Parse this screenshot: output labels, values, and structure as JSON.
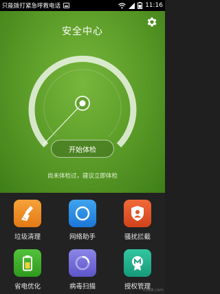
{
  "status_bar": {
    "emergency_text": "只能拨打紧急呼救电话",
    "time": "11:16"
  },
  "header": {
    "title": "安全中心",
    "settings_icon": "gear-icon"
  },
  "scan": {
    "button_label": "开始体检",
    "hint": "尚未体检过，建议立即体检"
  },
  "tools": [
    {
      "label": "垃圾清理",
      "icon": "broom-icon",
      "color": "#ee8f25"
    },
    {
      "label": "网络助手",
      "icon": "network-ring-icon",
      "color": "#2a8ce6"
    },
    {
      "label": "骚扰拦截",
      "icon": "shield-user-icon",
      "color": "#e0552a"
    },
    {
      "label": "省电优化",
      "icon": "battery-icon",
      "color": "#3fae2b"
    },
    {
      "label": "病毒扫描",
      "icon": "virus-scan-icon",
      "color": "#746ed8"
    },
    {
      "label": "授权管理",
      "icon": "permission-badge-icon",
      "color": "#22b08c"
    }
  ],
  "watermark": "it168.com"
}
